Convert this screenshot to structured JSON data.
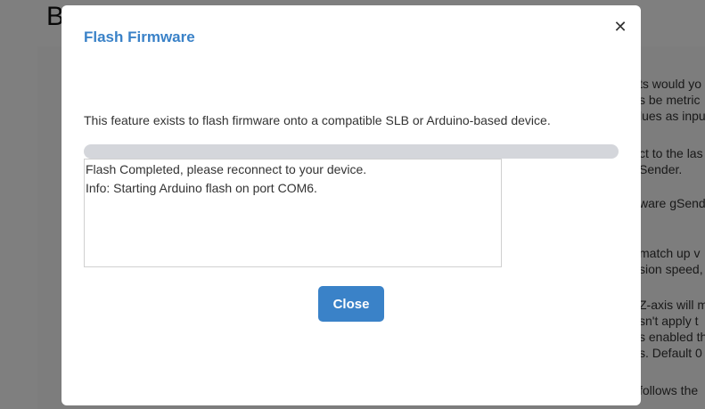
{
  "background": {
    "title": "B",
    "side_lines": [
      "ts would yo",
      "s be metric",
      "lues as inpu",
      "",
      "ct to the las",
      "Sender.",
      "",
      "ware gSend",
      "",
      "",
      "match up v",
      "sion speed,",
      "",
      "Z-axis will m",
      "sn't apply t",
      "s enabled th",
      "s. Default 0",
      "",
      "follows the"
    ]
  },
  "modal": {
    "title": "Flash Firmware",
    "close_icon": "close-icon",
    "description": "This feature exists to flash firmware onto a compatible SLB or Arduino-based device.",
    "progress": 1.0,
    "log_lines": [
      "Flash Completed, please reconnect to your device.",
      "Info: Starting Arduino flash on port COM6."
    ],
    "close_button_label": "Close"
  },
  "colors": {
    "accent": "#3a82c8",
    "progress_track": "#d4d6db",
    "overlay": "rgba(0,0,0,0.5)"
  }
}
